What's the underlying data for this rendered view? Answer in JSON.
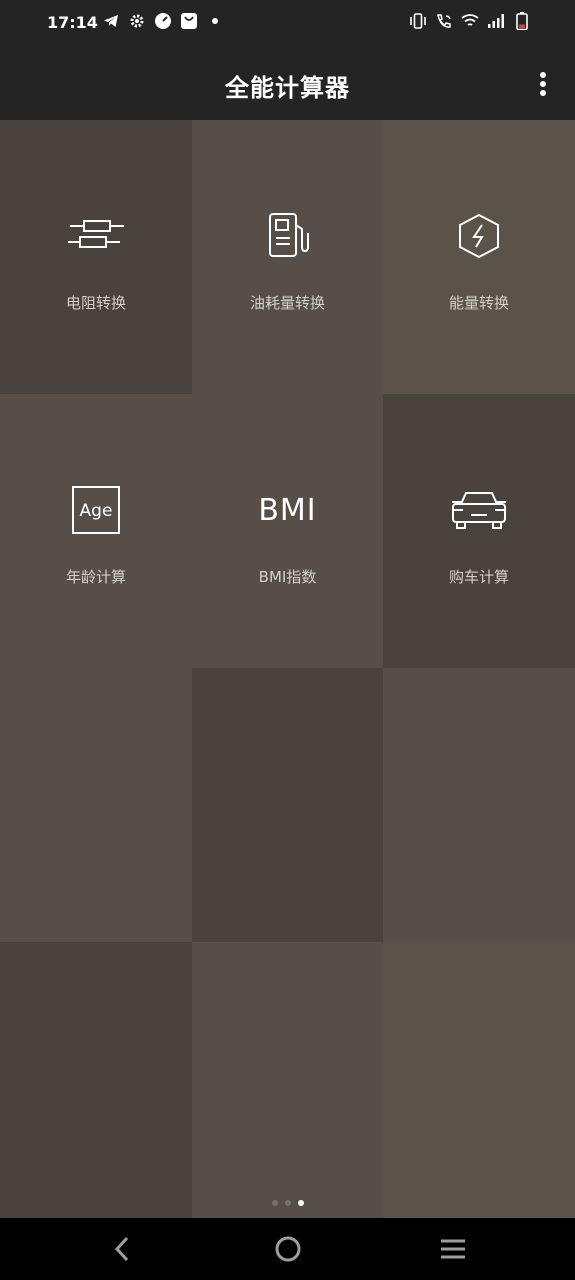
{
  "status_bar": {
    "time": "17:14",
    "left_icons": [
      "telegram-icon",
      "settings-icon",
      "speed-icon",
      "bag-icon",
      "dot-icon"
    ],
    "right_icons": [
      "vibrate-icon",
      "wifi-call-icon",
      "wifi-icon",
      "signal-icon",
      "battery-icon"
    ]
  },
  "app_bar": {
    "title": "全能计算器",
    "menu_icon": "more-vert-icon"
  },
  "tiles": [
    {
      "label": "电阻转换",
      "icon": "resistor-icon"
    },
    {
      "label": "油耗量转换",
      "icon": "fuel-pump-icon"
    },
    {
      "label": "能量转换",
      "icon": "energy-icon"
    },
    {
      "label": "年龄计算",
      "icon": "age-icon",
      "icon_text": "Age"
    },
    {
      "label": "BMI指数",
      "icon": "bmi-icon",
      "icon_text": "BMI"
    },
    {
      "label": "购车计算",
      "icon": "car-icon"
    }
  ],
  "pager": {
    "count": 3,
    "active_index": 2
  },
  "nav_bar": {
    "buttons": [
      "back-icon",
      "home-icon",
      "recents-icon"
    ]
  },
  "colors": {
    "dark_tile": "#4a423d",
    "mid_tile": "#574e47",
    "light_tile": "#5b5249",
    "bar": "#242424"
  }
}
